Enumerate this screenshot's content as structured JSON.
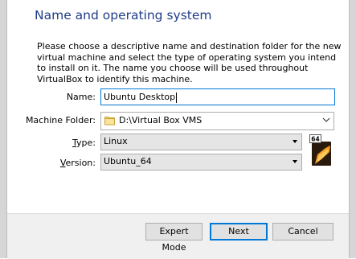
{
  "wizard": {
    "title": "Name and operating system",
    "description": "Please choose a descriptive name and destination folder for the new virtual machine and select the type of operating system you intend to install on it. The name you choose will be used throughout VirtualBox to identify this machine."
  },
  "form": {
    "name_label": "Name:",
    "name_value": "Ubuntu Desktop",
    "folder_label": "Machine Folder:",
    "folder_value": "D:\\Virtual Box VMS",
    "type_label_pre": "",
    "type_label_underlined": "T",
    "type_label_post": "ype:",
    "type_value": "Linux",
    "version_label_pre": "",
    "version_label_underlined": "V",
    "version_label_post": "ersion:",
    "version_value": "Ubuntu_64",
    "os_icon_badge": "64"
  },
  "buttons": {
    "expert_mode": "Expert Mode",
    "next": "Next",
    "cancel": "Cancel"
  },
  "colors": {
    "title": "#1f3c88",
    "focus_border": "#0078d7",
    "footer_bg": "#f0f0f0"
  },
  "icons": {
    "folder": "folder-icon",
    "dropdown": "chevron-down-icon",
    "os": "ubuntu-64-os-icon"
  }
}
